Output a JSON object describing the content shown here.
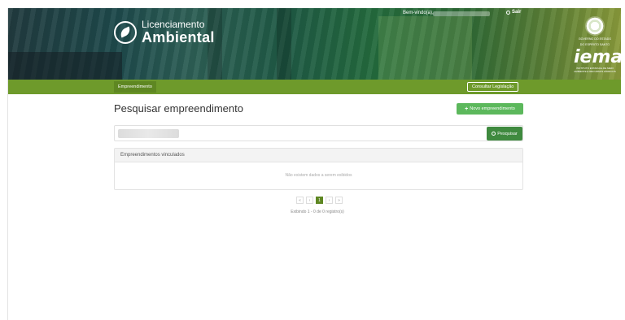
{
  "header": {
    "logo_line1": "Licenciamento",
    "logo_line2": "Ambiental",
    "welcome": "Bem-vindo(a),",
    "logout": "Sair",
    "gov_text_line1": "GOVERNO DO ESTADO",
    "gov_text_line2": "DO ESPÍRITO SANTO",
    "iema": "iema",
    "iema_sub": "INSTITUTO ESTADUAL DE MEIO AMBIENTE E RECURSOS HÍDRICOS"
  },
  "navbar": {
    "active_item": "Empreendimento",
    "right_button": "Consultar Legislação"
  },
  "main": {
    "title": "Pesquisar empreendimento",
    "new_button": "Novo empreendimento",
    "search": {
      "placeholder": "",
      "button": "Pesquisar"
    },
    "panel": {
      "heading": "Empreendimentos vinculados",
      "empty_message": "Não existem dados a serem exibidos"
    },
    "pagination": {
      "first": "«",
      "prev": "‹",
      "current": "1",
      "next": "›",
      "last": "»"
    },
    "showing": "Exibindo 1 - 0 de 0 registro(s)"
  },
  "colors": {
    "nav_green": "#6e9a2b",
    "button_green": "#5cb85c",
    "search_button": "#3f8a3f"
  }
}
